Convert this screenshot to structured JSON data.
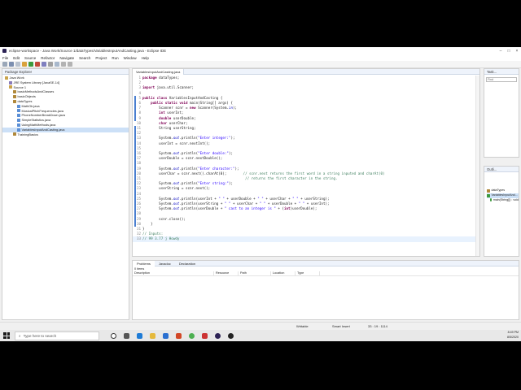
{
  "window": {
    "title": "eclipse-workspace - Java Work/Source 1/dataTypes/VariablesInputAndCasting.java - Eclipse IDE"
  },
  "menu": [
    "File",
    "Edit",
    "Source",
    "Refactor",
    "Navigate",
    "Search",
    "Project",
    "Run",
    "Window",
    "Help"
  ],
  "package_explorer": {
    "tab": "Package Explorer",
    "items": [
      {
        "label": "Java Work",
        "indent": 0,
        "icon": "#c9a34a"
      },
      {
        "label": "JRE System Library [JavaSE-14]",
        "indent": 1,
        "icon": "#8a7bb8"
      },
      {
        "label": "Source 1",
        "indent": 1,
        "icon": "#c9a34a"
      },
      {
        "label": "basicMethodsAndClasses",
        "indent": 2,
        "icon": "#b0883a"
      },
      {
        "label": "basicObjects",
        "indent": 2,
        "icon": "#b0883a"
      },
      {
        "label": "dataTypes",
        "indent": 2,
        "icon": "#b0883a"
      },
      {
        "label": "MathOb.java",
        "indent": 3,
        "icon": "#5b8fd6"
      },
      {
        "label": "MusicalPitchFrequencies.java",
        "indent": 3,
        "icon": "#5b8fd6"
      },
      {
        "label": "PhoneNumberBreakDown.java",
        "indent": 3,
        "icon": "#5b8fd6"
      },
      {
        "label": "SimpleStatistics.java",
        "indent": 3,
        "icon": "#5b8fd6"
      },
      {
        "label": "UsingMathMethods.java",
        "indent": 3,
        "icon": "#5b8fd6"
      },
      {
        "label": "VariablesInputAndCasting.java",
        "indent": 3,
        "icon": "#5b8fd6",
        "selected": true
      },
      {
        "label": "TrainingBasics",
        "indent": 2,
        "icon": "#b0883a"
      }
    ]
  },
  "editor": {
    "tab": "VariablesInputAndCasting.java",
    "lines": [
      {
        "n": "1",
        "html": "<span class=\"kw\">package</span> dataTypes;"
      },
      {
        "n": "2",
        "html": ""
      },
      {
        "n": "3",
        "html": "<span class=\"kw\">import</span> java.util.Scanner;"
      },
      {
        "n": "4",
        "html": ""
      },
      {
        "n": "5",
        "html": "<span class=\"kw\">public class</span> VariablesInputAndCasting {"
      },
      {
        "n": "6",
        "html": "    <span class=\"kw\">public static void</span> main(String[] args) {"
      },
      {
        "n": "7",
        "html": "        Scanner scnr = <span class=\"kw\">new</span> Scanner(System.<span class=\"fld\">in</span>);"
      },
      {
        "n": "8",
        "html": "        <span class=\"kw\">int</span> userInt;"
      },
      {
        "n": "9",
        "html": "        <span class=\"kw\">double</span> userDouble;"
      },
      {
        "n": "10",
        "html": "        <span class=\"kw\">char</span> userChar;"
      },
      {
        "n": "11",
        "html": "        String userString;"
      },
      {
        "n": "12",
        "html": ""
      },
      {
        "n": "13",
        "html": "        System.<span class=\"fld\">out</span>.println(<span class=\"str\">\"Enter integer:\"</span>);"
      },
      {
        "n": "14",
        "html": "        userInt = scnr.nextInt();"
      },
      {
        "n": "15",
        "html": ""
      },
      {
        "n": "16",
        "html": "        System.<span class=\"fld\">out</span>.println(<span class=\"str\">\"Enter double:\"</span>);"
      },
      {
        "n": "17",
        "html": "        userDouble = scnr.nextDouble();"
      },
      {
        "n": "18",
        "html": ""
      },
      {
        "n": "19",
        "html": "        System.<span class=\"fld\">out</span>.println(<span class=\"str\">\"Enter character:\"</span>);"
      },
      {
        "n": "20",
        "html": "        userChar = scnr.next().charAt(0);        <span class=\"com\">// scnr.next returns the first word in a string inputed and charAt(0)</span>"
      },
      {
        "n": "21",
        "html": "                                                  <span class=\"com\">// returns the first character in the string.</span>"
      },
      {
        "n": "22",
        "html": "        System.<span class=\"fld\">out</span>.println(<span class=\"str\">\"Enter string:\"</span>);"
      },
      {
        "n": "23",
        "html": "        userString = scnr.next();"
      },
      {
        "n": "24",
        "html": ""
      },
      {
        "n": "25",
        "html": "        System.<span class=\"fld\">out</span>.println(userInt + <span class=\"str\">\" \"</span> + userDouble + <span class=\"str\">\" \"</span> + userChar + <span class=\"str\">\" \"</span> + userString);"
      },
      {
        "n": "26",
        "html": "        System.<span class=\"fld\">out</span>.println(userString + <span class=\"str\">\" \"</span> + userChar + <span class=\"str\">\" \"</span> + userDouble + <span class=\"str\">\" \"</span> + userInt);"
      },
      {
        "n": "27",
        "html": "        System.<span class=\"fld\">out</span>.println(userDouble + <span class=\"str\">\" cast to an integer is \"</span> + (<span class=\"kw\">int</span>)userDouble);"
      },
      {
        "n": "28",
        "html": ""
      },
      {
        "n": "29",
        "html": "        scnr.close();"
      },
      {
        "n": "30",
        "html": "    }"
      },
      {
        "n": "31",
        "html": "}"
      },
      {
        "n": "32",
        "html": "<span class=\"com\">// Inputs:</span>"
      },
      {
        "n": "33",
        "html": "<span class=\"com\">// 99 3.77 j Howdy</span>",
        "current": true
      }
    ]
  },
  "right_panels": {
    "task_tab": "Task...",
    "find_placeholder": "Find",
    "outline_tab": "Outli...",
    "outline_items": [
      "dataTypes",
      "VariablesInputAnd...",
      "main(String[]) : void"
    ]
  },
  "bottom_panel": {
    "tabs": [
      "Problems",
      "Javadoc",
      "Declaration"
    ],
    "count": "0 items",
    "columns": [
      "Description",
      "Resource",
      "Path",
      "Location",
      "Type"
    ]
  },
  "status": {
    "writable": "Writable",
    "insert": "Smart Insert",
    "position": "33 : 19 : 1114"
  },
  "taskbar": {
    "search_placeholder": "Type here to search",
    "time": "8:49 PM",
    "date": "8/5/2020"
  }
}
